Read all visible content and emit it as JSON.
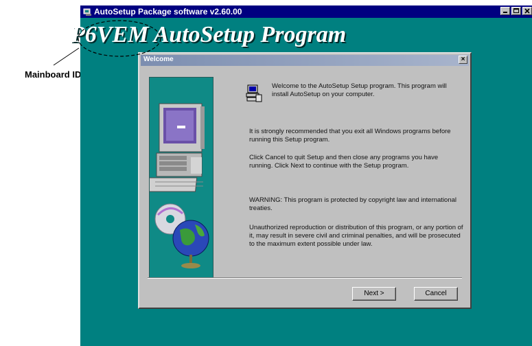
{
  "annotation": {
    "label": "Mainboard ID"
  },
  "app": {
    "title": "AutoSetup Package software v2.60.00",
    "heading_model": "P6VEM",
    "heading_rest": "AutoSetup Program"
  },
  "dialog": {
    "title": "Welcome",
    "close_label": "×",
    "welcome_text": "Welcome to the AutoSetup Setup program.  This program will install AutoSetup on your computer.",
    "recommend_text": "It is strongly recommended that you exit all Windows programs before running this Setup program.",
    "cancel_info_text": "Click Cancel to quit Setup and then close any programs you have running.  Click Next to continue with the Setup program.",
    "warning_text": "WARNING: This program is protected by copyright law and international treaties.",
    "unauthorized_text": "Unauthorized reproduction or distribution of this program, or any portion of it, may result in severe civil and criminal penalties, and will be prosecuted to the maximum extent possible under law.",
    "next_label": "Next >",
    "cancel_label": "Cancel"
  },
  "colors": {
    "desktop_teal": "#008080",
    "title_navy": "#000080",
    "dialog_gray": "#c0c0c0"
  },
  "icons": [
    "setup-app-icon",
    "minimize-icon",
    "maximize-icon",
    "close-icon",
    "setup-computer-icon",
    "computer-illustration",
    "globe-cd-illustration"
  ]
}
